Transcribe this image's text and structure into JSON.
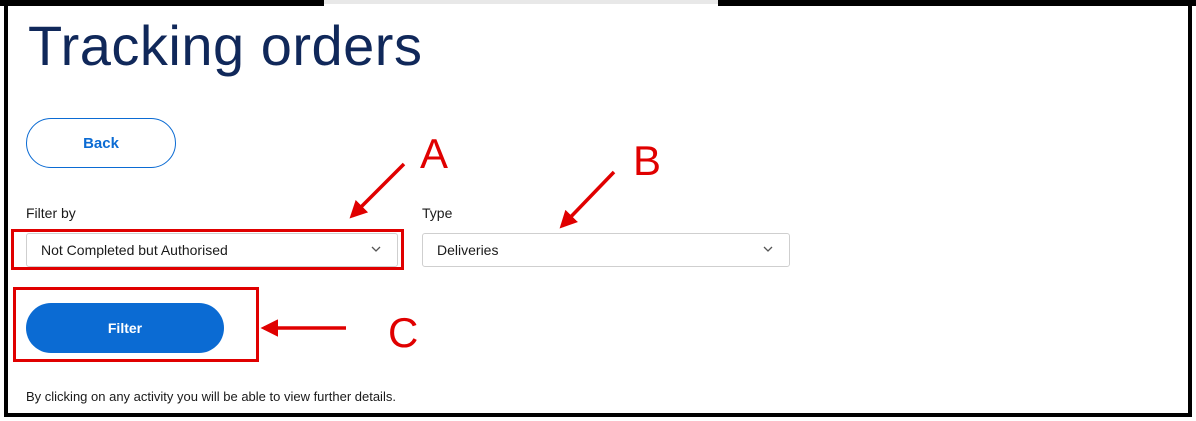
{
  "page": {
    "title": "Tracking orders",
    "back_label": "Back",
    "note": "By clicking on any activity you will be able to view further details."
  },
  "filters": {
    "filter_by_label": "Filter by",
    "filter_by_value": "Not Completed but Authorised",
    "type_label": "Type",
    "type_value": "Deliveries",
    "submit_label": "Filter"
  },
  "annotations": {
    "a": "A",
    "b": "B",
    "c": "C",
    "color": "#e00000"
  },
  "colors": {
    "title": "#10285a",
    "accent": "#0b6bd3"
  }
}
